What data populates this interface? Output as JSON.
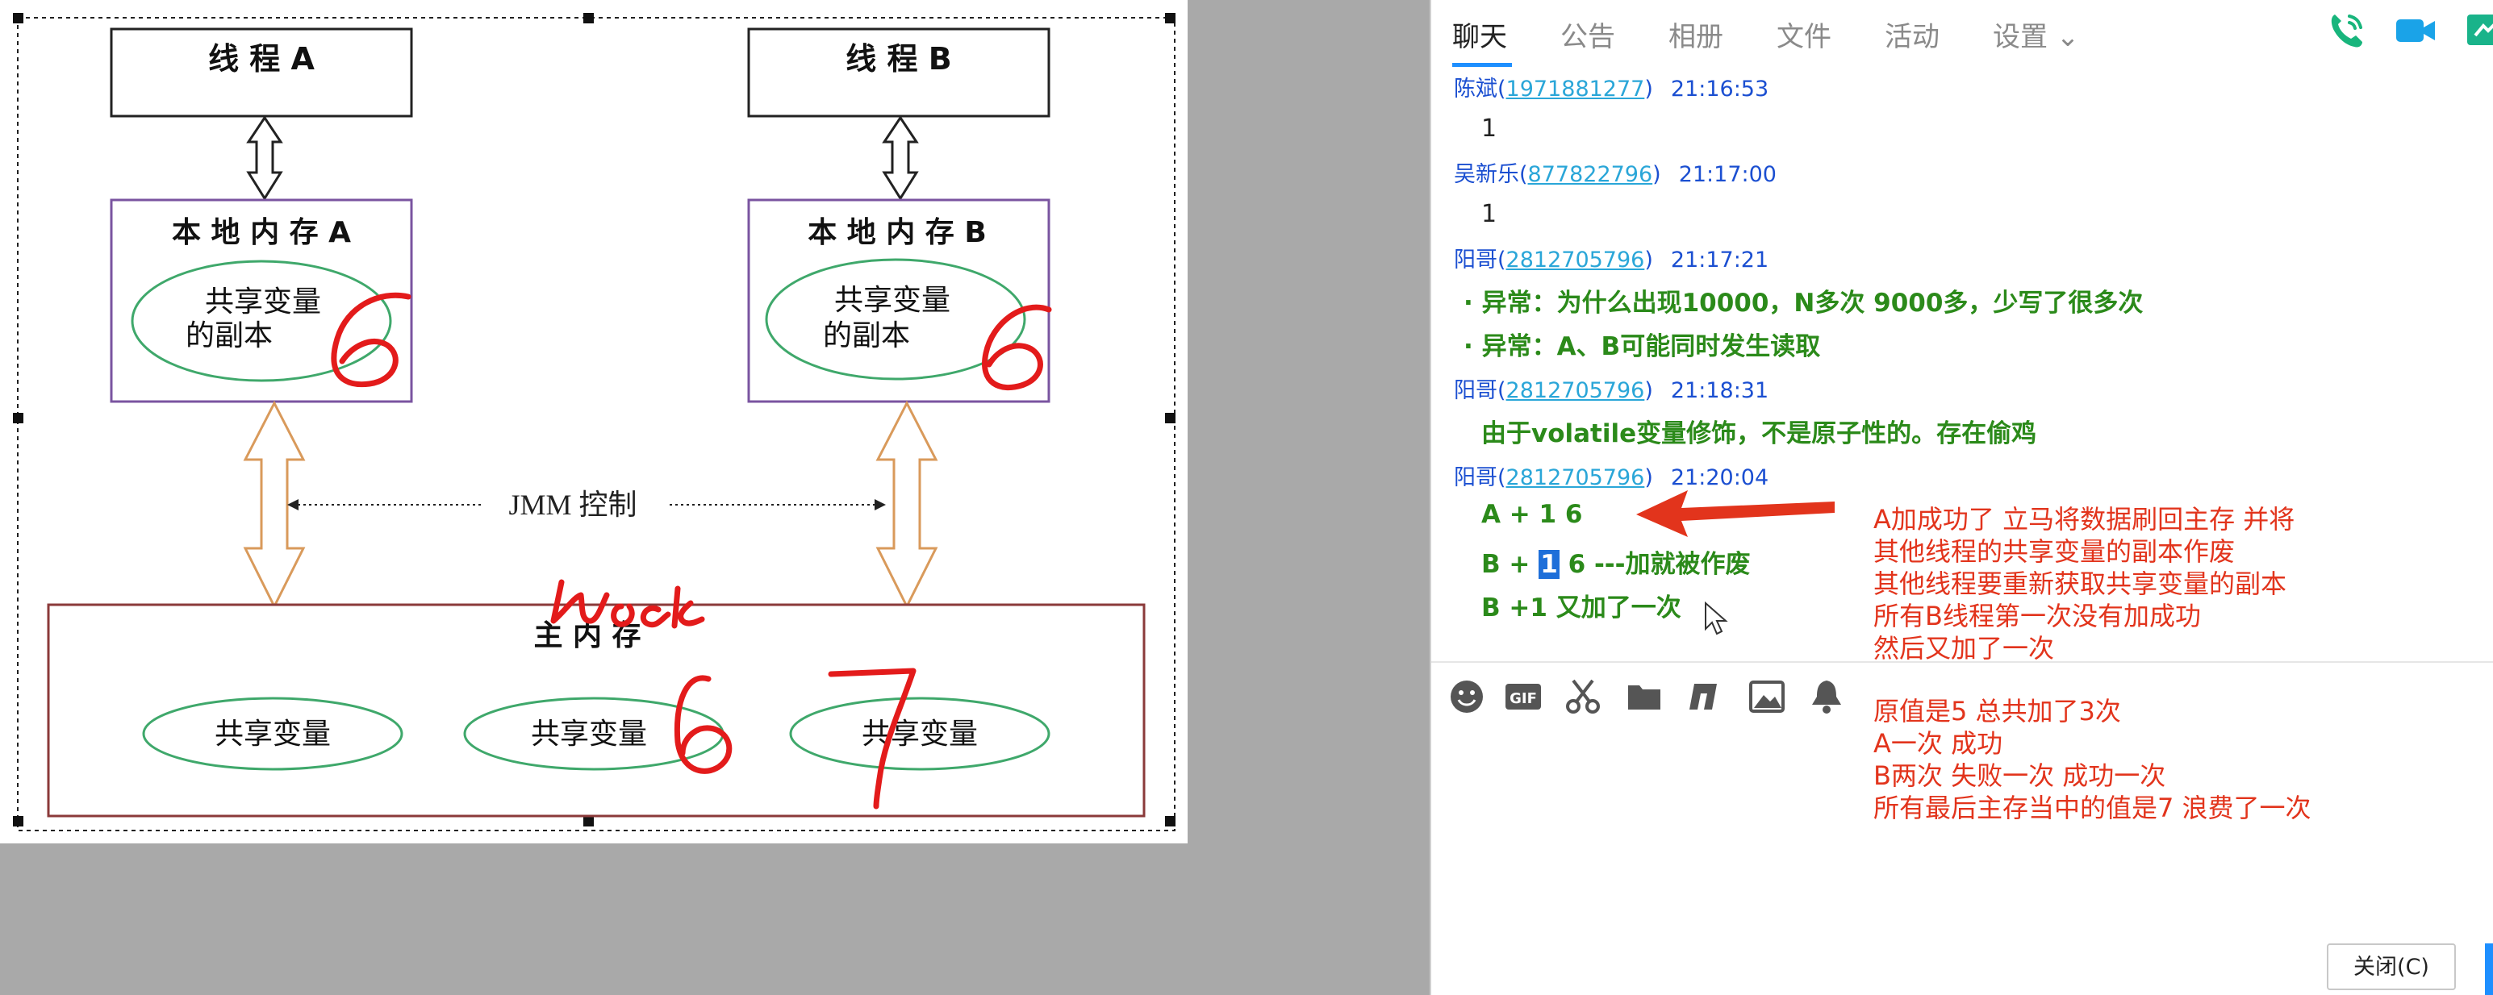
{
  "diagram": {
    "thread_a": "线 程 A",
    "thread_b": "线 程 B",
    "local_mem_a": "本 地 内 存 A",
    "local_mem_b": "本 地 内 存 B",
    "shared_copy_line1": "共享变量",
    "shared_copy_line2": "的副本",
    "jmm_label": "JMM 控制",
    "main_mem": "主 内 存",
    "shared_var": "共享变量",
    "handwriting": [
      "6",
      "6",
      "lock",
      "6",
      "7"
    ]
  },
  "tabs": [
    "聊天",
    "公告",
    "相册",
    "文件",
    "活动",
    "设置 ⌄"
  ],
  "header_icons": [
    "phone-icon",
    "video-icon",
    "classroom-icon"
  ],
  "messages": [
    {
      "name": "陈斌",
      "id": "1971881277",
      "time": "21:16:53",
      "lines": [
        "1"
      ],
      "style": "plain"
    },
    {
      "name": "吴新乐",
      "id": "877822796",
      "time": "21:17:00",
      "lines": [
        "1"
      ],
      "style": "plain"
    },
    {
      "name": "阳哥",
      "id": "2812705796",
      "time": "21:17:21",
      "lines": [
        "· 异常：为什么出现10000，N多次 9000多，少写了很多次",
        "· 异常：A、B可能同时发生读取"
      ],
      "style": "green"
    },
    {
      "name": "阳哥",
      "id": "2812705796",
      "time": "21:18:31",
      "lines": [
        "由于volatile变量修饰，不是原子性的。存在偷鸡"
      ],
      "style": "green"
    },
    {
      "name": "阳哥",
      "id": "2812705796",
      "time": "21:20:04",
      "lines": [
        "A + 1 6",
        "B +",
        "1",
        "6 ---加就被作废",
        "B +1 又加了一次"
      ],
      "style": "green"
    }
  ],
  "toolbar_icons": [
    "emoji-icon",
    "gif-icon",
    "scissors-icon",
    "folder-icon",
    "music-icon",
    "image-icon",
    "bell-icon"
  ],
  "notes": {
    "top": [
      "A加成功了 立马将数据刷回主存 并将",
      "其他线程的共享变量的副本作废",
      "其他线程要重新获取共享变量的副本",
      "所有B线程第一次没有加成功",
      "然后又加了一次"
    ],
    "bottom": [
      "原值是5 总共加了3次",
      "A一次 成功",
      "B两次 失败一次 成功一次",
      "所有最后主存当中的值是7 浪费了一次"
    ]
  },
  "close_button": "关闭(C)",
  "colors": {
    "accent": "#1e8fff",
    "annotation_red": "#e2341c",
    "message_green": "#2b8a1a",
    "sender_blue": "#1b4fd1"
  }
}
